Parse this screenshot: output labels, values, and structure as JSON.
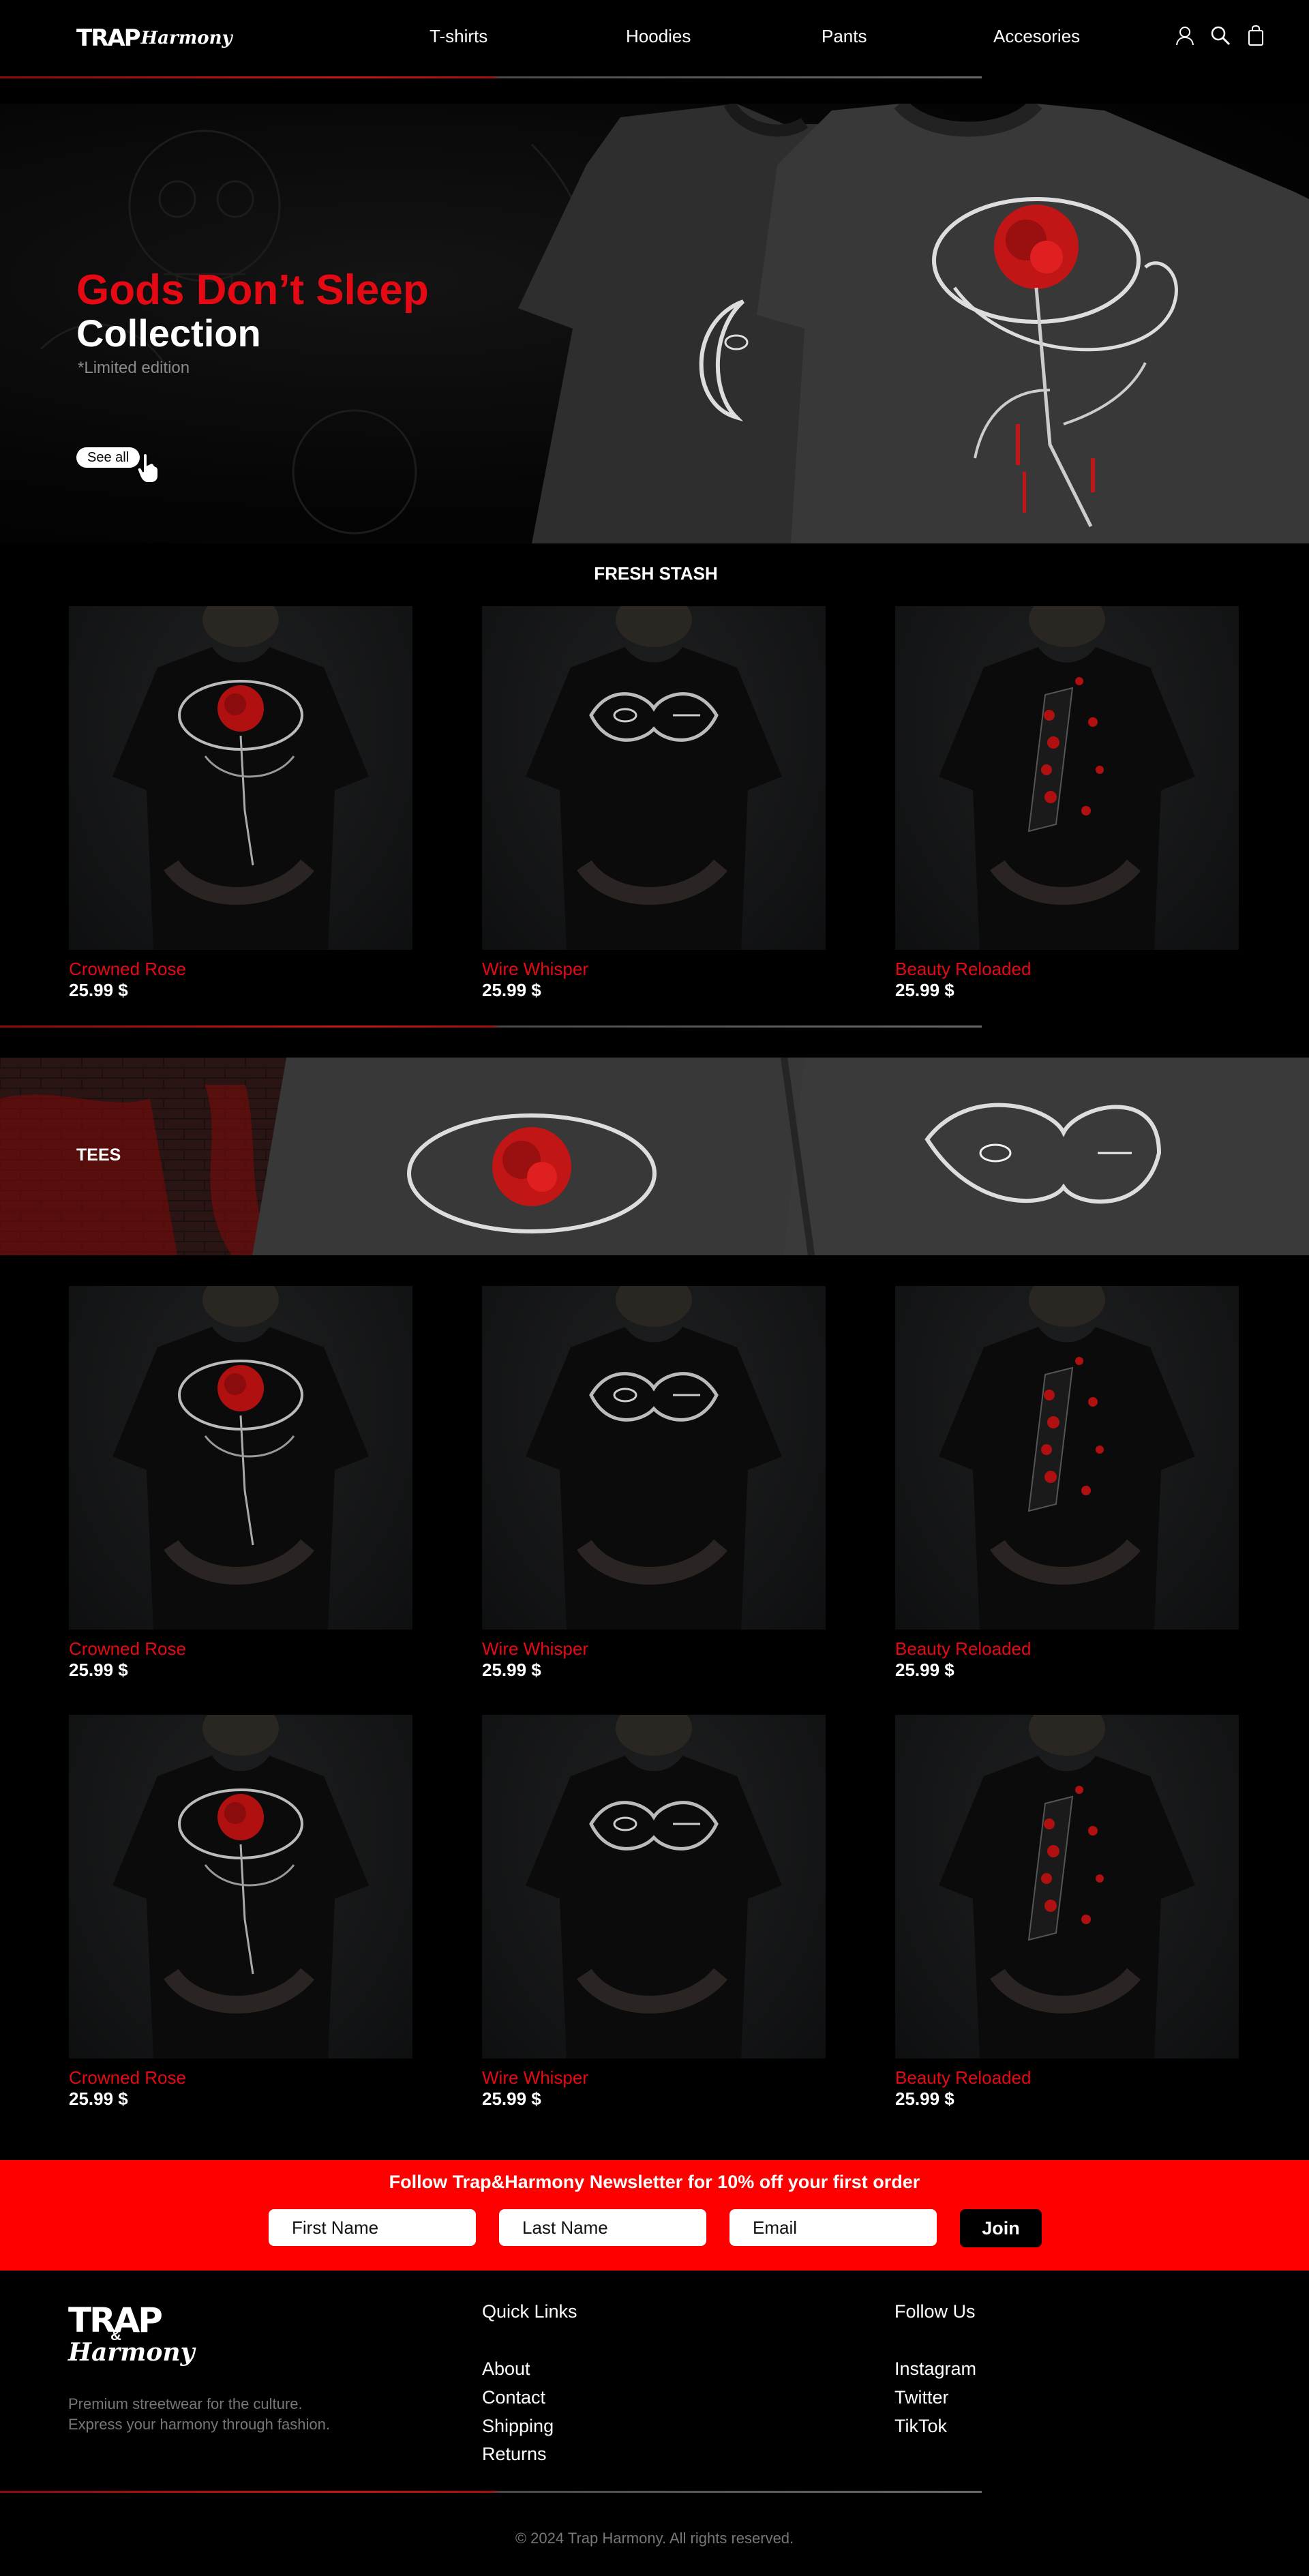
{
  "brand": {
    "top_primary": "TRAP",
    "top_secondary": "Harmony",
    "footer_primary": "TRAP",
    "footer_amp": "&",
    "footer_secondary": "Harmony"
  },
  "nav": {
    "items": [
      "T-shirts",
      "Hoodies",
      "Pants",
      "Accesories"
    ]
  },
  "header_icons": [
    "user-icon",
    "search-icon",
    "bag-icon"
  ],
  "hero": {
    "title_red": "Gods Don’t Sleep",
    "title_white": "Collection",
    "subtitle": "*Limited edition",
    "button": "See all"
  },
  "fresh_stash": {
    "title": "FRESH STASH",
    "products": [
      {
        "name": "Crowned Rose",
        "price": "25.99 $"
      },
      {
        "name": "Wire Whisper",
        "price": "25.99 $"
      },
      {
        "name": "Beauty Reloaded",
        "price": "25.99 $"
      }
    ]
  },
  "tees": {
    "title": "TEES",
    "products": [
      {
        "name": "Crowned Rose",
        "price": "25.99 $"
      },
      {
        "name": "Wire Whisper",
        "price": "25.99 $"
      },
      {
        "name": "Beauty Reloaded",
        "price": "25.99 $"
      },
      {
        "name": "Crowned Rose",
        "price": "25.99 $"
      },
      {
        "name": "Wire Whisper",
        "price": "25.99 $"
      },
      {
        "name": "Beauty Reloaded",
        "price": "25.99 $"
      }
    ]
  },
  "newsletter": {
    "title": "Follow Trap&Harmony Newsletter for 10% off your first order",
    "first_name_placeholder": "First Name",
    "last_name_placeholder": "Last Name",
    "email_placeholder": "Email",
    "join": "Join"
  },
  "footer": {
    "tagline_1": "Premium streetwear for the culture.",
    "tagline_2": "Express your harmony through fashion.",
    "quick_links_title": "Quick Links",
    "quick_links": [
      "About",
      "Contact",
      "Shipping",
      "Returns"
    ],
    "follow_title": "Follow Us",
    "social_links": [
      "Instagram",
      "Twitter",
      "TikTok"
    ],
    "copyright": "© 2024 Trap Harmony. All rights reserved."
  },
  "colors": {
    "accent": "#e50914",
    "newsletter_bg": "#ff0000",
    "background": "#000000"
  }
}
